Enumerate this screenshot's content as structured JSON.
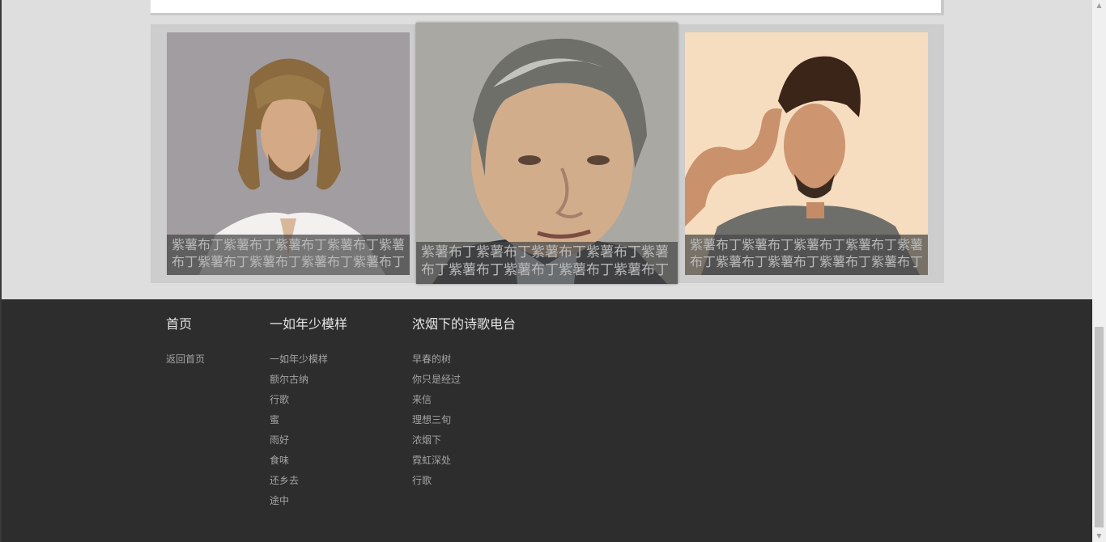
{
  "gallery": {
    "cards": [
      {
        "caption": "紫薯布丁紫薯布丁紫薯布丁紫薯布丁紫薯布丁紫薯布丁紫薯布丁紫薯布丁紫薯布丁"
      },
      {
        "caption": "紫薯布丁紫薯布丁紫薯布丁紫薯布丁紫薯布丁紫薯布丁紫薯布丁紫薯布丁紫薯布丁"
      },
      {
        "caption": "紫薯布丁紫薯布丁紫薯布丁紫薯布丁紫薯布丁紫薯布丁紫薯布丁紫薯布丁紫薯布丁"
      }
    ]
  },
  "footer": {
    "columns": [
      {
        "heading": "首页",
        "links": [
          "返回首页"
        ]
      },
      {
        "heading": "一如年少模样",
        "links": [
          "一如年少模样",
          "额尔古纳",
          "行歌",
          "蜜",
          "雨好",
          "食味",
          "还乡去",
          "途中"
        ]
      },
      {
        "heading": "浓烟下的诗歌电台",
        "links": [
          "早春的树",
          "你只是经过",
          "来信",
          "理想三旬",
          "浓烟下",
          "霓虹深处",
          "行歌"
        ]
      }
    ]
  },
  "colors": {
    "page_bg": "#dedede",
    "gallery_bg": "#cdcdcd",
    "footer_bg": "#2d2d2d",
    "caption_bg": "rgba(70,70,70,0.72)",
    "caption_text": "#b9b9b9"
  },
  "icons": {
    "scroll_up": "scroll-up-arrow-icon",
    "scroll_down": "scroll-down-arrow-icon"
  }
}
